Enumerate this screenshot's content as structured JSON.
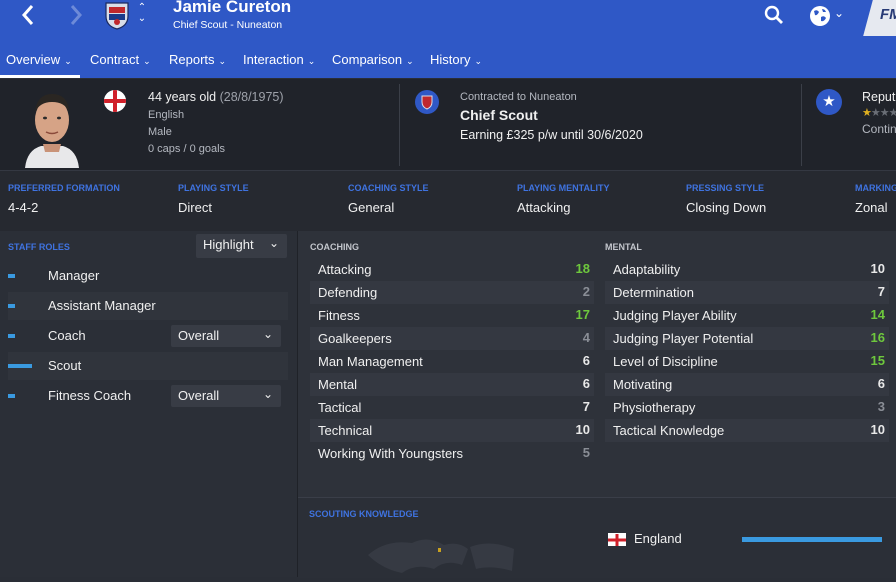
{
  "header": {
    "name": "Jamie Cureton",
    "subtitle": "Chief Scout - Nuneaton",
    "logo_text": "FM"
  },
  "tabs": [
    {
      "label": "Overview",
      "active": true
    },
    {
      "label": "Contract"
    },
    {
      "label": "Reports"
    },
    {
      "label": "Interaction"
    },
    {
      "label": "Comparison"
    },
    {
      "label": "History"
    }
  ],
  "profile": {
    "age_label": "44 years old",
    "dob": "(28/8/1975)",
    "nationality": "English",
    "gender": "Male",
    "caps_goals": "0 caps / 0 goals"
  },
  "contract": {
    "label": "Contracted to Nuneaton",
    "role": "Chief Scout",
    "earning": "Earning £325 p/w until 30/6/2020"
  },
  "reputation": {
    "label": "Reput",
    "sub": "Contin",
    "stars": 0.5
  },
  "preferences": [
    {
      "label": "PREFERRED FORMATION",
      "value": "4-4-2"
    },
    {
      "label": "PLAYING STYLE",
      "value": "Direct"
    },
    {
      "label": "COACHING STYLE",
      "value": "General"
    },
    {
      "label": "PLAYING MENTALITY",
      "value": "Attacking"
    },
    {
      "label": "PRESSING STYLE",
      "value": "Closing Down"
    },
    {
      "label": "MARKING",
      "value": "Zonal"
    }
  ],
  "staff_roles": {
    "label": "STAFF ROLES",
    "highlight": "Highlight",
    "roles": [
      {
        "name": "Manager",
        "level": 0.25
      },
      {
        "name": "Assistant Manager",
        "level": 0.25
      },
      {
        "name": "Coach",
        "level": 0.25,
        "select": "Overall"
      },
      {
        "name": "Scout",
        "level": 1.0
      },
      {
        "name": "Fitness Coach",
        "level": 0.25,
        "select": "Overall"
      }
    ]
  },
  "coaching": {
    "label": "COACHING",
    "attributes": [
      {
        "name": "Attacking",
        "value": "18",
        "tier": "high"
      },
      {
        "name": "Defending",
        "value": "2",
        "tier": "low"
      },
      {
        "name": "Fitness",
        "value": "17",
        "tier": "high"
      },
      {
        "name": "Goalkeepers",
        "value": "4",
        "tier": "low"
      },
      {
        "name": "Man Management",
        "value": "6",
        "tier": "mid"
      },
      {
        "name": "Mental",
        "value": "6",
        "tier": "mid"
      },
      {
        "name": "Tactical",
        "value": "7",
        "tier": "mid"
      },
      {
        "name": "Technical",
        "value": "10",
        "tier": "mid"
      },
      {
        "name": "Working With Youngsters",
        "value": "5",
        "tier": "low"
      }
    ]
  },
  "mental": {
    "label": "MENTAL",
    "attributes": [
      {
        "name": "Adaptability",
        "value": "10",
        "tier": "mid"
      },
      {
        "name": "Determination",
        "value": "7",
        "tier": "mid"
      },
      {
        "name": "Judging Player Ability",
        "value": "14",
        "tier": "high"
      },
      {
        "name": "Judging Player Potential",
        "value": "16",
        "tier": "high"
      },
      {
        "name": "Level of Discipline",
        "value": "15",
        "tier": "high"
      },
      {
        "name": "Motivating",
        "value": "6",
        "tier": "mid"
      },
      {
        "name": "Physiotherapy",
        "value": "3",
        "tier": "low"
      },
      {
        "name": "Tactical Knowledge",
        "value": "10",
        "tier": "mid"
      }
    ]
  },
  "scouting": {
    "label": "SCOUTING KNOWLEDGE",
    "country": "England",
    "knowledge": 1.0
  }
}
